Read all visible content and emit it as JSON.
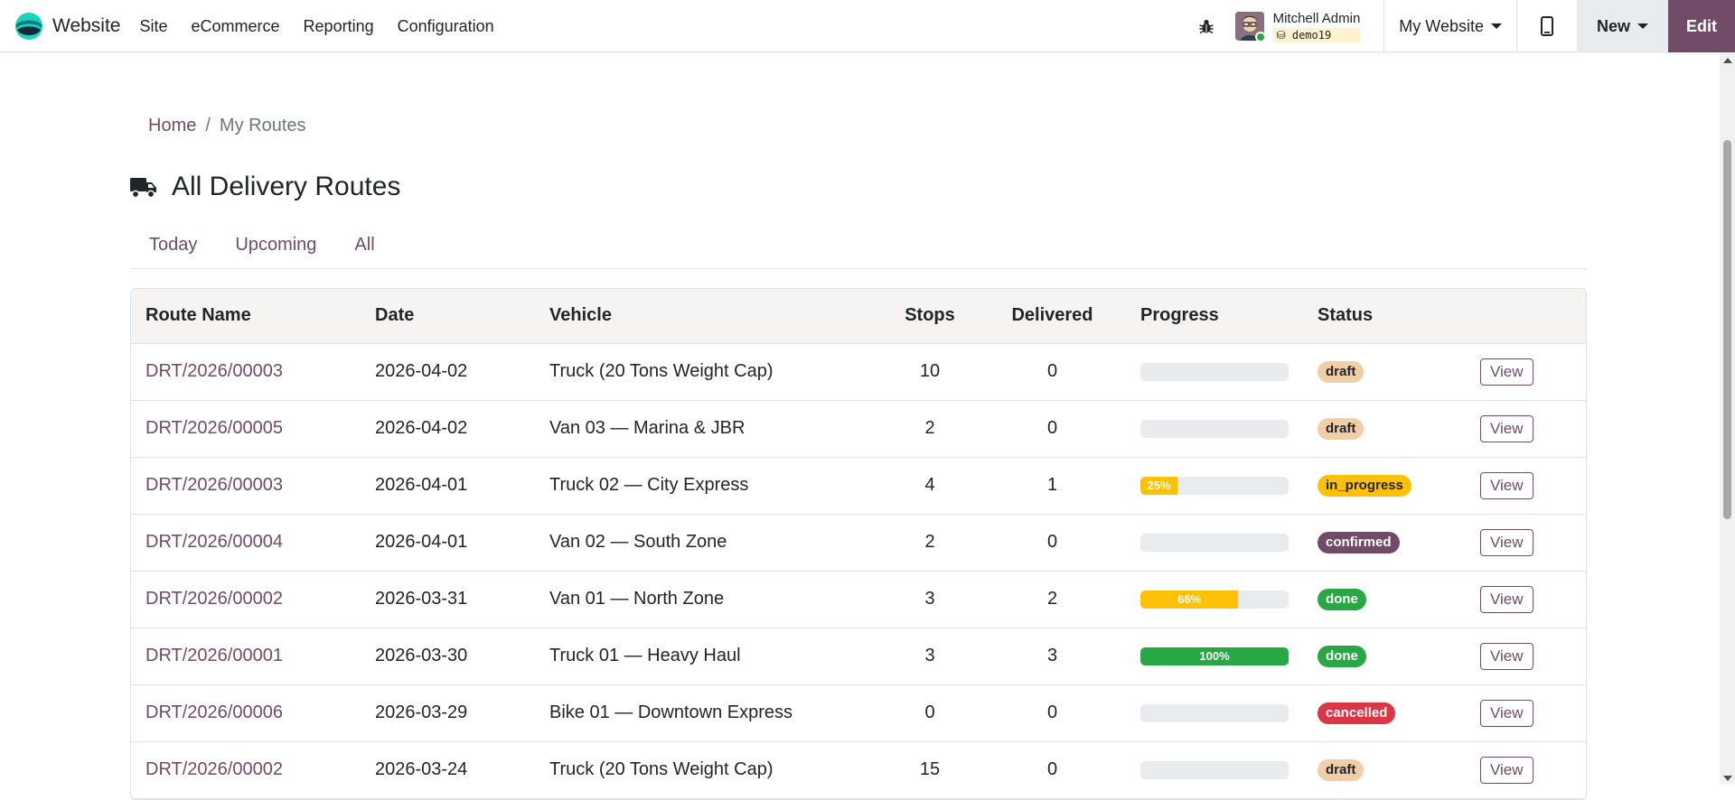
{
  "topbar": {
    "app_name": "Website",
    "menu": [
      "Site",
      "eCommerce",
      "Reporting",
      "Configuration"
    ],
    "user_name": "Mitchell Admin",
    "db_name": "demo19",
    "website_selector": "My Website",
    "new_label": "New",
    "edit_label": "Edit",
    "brand_color": "#714b67"
  },
  "breadcrumb": {
    "home": "Home",
    "separator": "/",
    "current": "My Routes"
  },
  "page": {
    "title": "All Delivery Routes",
    "title_icon": "truck-icon"
  },
  "tabs": [
    "Today",
    "Upcoming",
    "All"
  ],
  "table": {
    "headers": [
      "Route Name",
      "Date",
      "Vehicle",
      "Stops",
      "Delivered",
      "Progress",
      "Status",
      ""
    ],
    "view_label": "View",
    "rows": [
      {
        "name": "DRT/2026/00003",
        "date": "2026-04-02",
        "vehicle": "Truck (20 Tons Weight Cap)",
        "stops": "10",
        "delivered": "0",
        "progress": 0,
        "progress_label": "",
        "status": "draft"
      },
      {
        "name": "DRT/2026/00005",
        "date": "2026-04-02",
        "vehicle": "Van 03 — Marina & JBR",
        "stops": "2",
        "delivered": "0",
        "progress": 0,
        "progress_label": "",
        "status": "draft"
      },
      {
        "name": "DRT/2026/00003",
        "date": "2026-04-01",
        "vehicle": "Truck 02 — City Express",
        "stops": "4",
        "delivered": "1",
        "progress": 25,
        "progress_label": "25%",
        "status": "in_progress"
      },
      {
        "name": "DRT/2026/00004",
        "date": "2026-04-01",
        "vehicle": "Van 02 — South Zone",
        "stops": "2",
        "delivered": "0",
        "progress": 0,
        "progress_label": "",
        "status": "confirmed"
      },
      {
        "name": "DRT/2026/00002",
        "date": "2026-03-31",
        "vehicle": "Van 01 — North Zone",
        "stops": "3",
        "delivered": "2",
        "progress": 66,
        "progress_label": "66%",
        "status": "done"
      },
      {
        "name": "DRT/2026/00001",
        "date": "2026-03-30",
        "vehicle": "Truck 01 — Heavy Haul",
        "stops": "3",
        "delivered": "3",
        "progress": 100,
        "progress_label": "100%",
        "status": "done"
      },
      {
        "name": "DRT/2026/00006",
        "date": "2026-03-29",
        "vehicle": "Bike 01 — Downtown Express",
        "stops": "0",
        "delivered": "0",
        "progress": 0,
        "progress_label": "",
        "status": "cancelled"
      },
      {
        "name": "DRT/2026/00002",
        "date": "2026-03-24",
        "vehicle": "Truck (20 Tons Weight Cap)",
        "stops": "15",
        "delivered": "0",
        "progress": 0,
        "progress_label": "",
        "status": "draft"
      }
    ]
  },
  "status_colors": {
    "draft": {
      "bg": "#f0cfa8",
      "fg": "#212529"
    },
    "in_progress": {
      "bg": "#ffc107",
      "fg": "#212529"
    },
    "confirmed": {
      "bg": "#714b67",
      "fg": "#ffffff"
    },
    "done": {
      "bg": "#28a745",
      "fg": "#ffffff"
    },
    "cancelled": {
      "bg": "#dc3545",
      "fg": "#ffffff"
    }
  },
  "progress_colors": {
    "partial": "#ffc107",
    "complete": "#28a745"
  }
}
